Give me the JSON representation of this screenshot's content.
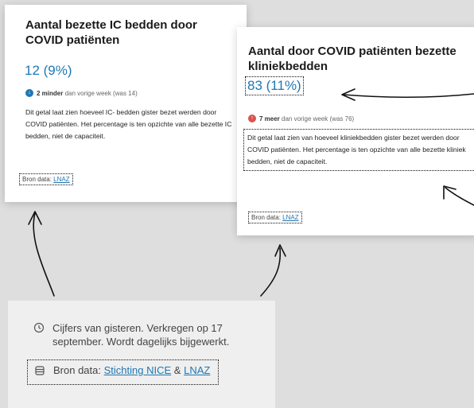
{
  "card_ic": {
    "title": "Aantal bezette IC bedden door COVID patiënten",
    "value": "12 (9%)",
    "change_amount": "2 minder",
    "change_rest": "dan vorige week (was 14)",
    "description": "Dit getal laat zien hoeveel IC- bedden gister bezet werden door COVID patiënten. Het percentage is ten opzichte van alle bezette IC bedden, niet de capaciteit.",
    "source_label": "Bron data:",
    "source_link": "LNAZ"
  },
  "card_clinic": {
    "title": "Aantal door COVID patiënten bezette kliniekbedden",
    "value": "83 (11%)",
    "change_amount": "7 meer",
    "change_rest": "dan vorige week (was 76)",
    "description": "Dit getal laat zien van hoeveel kliniekbedden gister bezet werden door COVID patiënten.  Het percentage is ten opzichte van alle bezette kliniek bedden, niet de capaciteit.",
    "source_label": "Bron data:",
    "source_link": "LNAZ"
  },
  "info_panel": {
    "updated_text": "Cijfers van gisteren. Verkregen op 17 september. Wordt dagelijks bijgewerkt.",
    "source_label": "Bron data:",
    "source_link_1": "Stichting NICE",
    "source_sep": "&",
    "source_link_2": "LNAZ"
  },
  "icons": {
    "clock": "clock-icon",
    "database": "database-icon",
    "decrease": "arrow-down-icon",
    "increase": "arrow-up-icon"
  },
  "colors": {
    "accent": "#1f77b4",
    "decrease": "#1f77b4",
    "increase": "#d9534f",
    "background": "#dedede",
    "card": "#ffffff",
    "info_panel": "#efefef"
  }
}
